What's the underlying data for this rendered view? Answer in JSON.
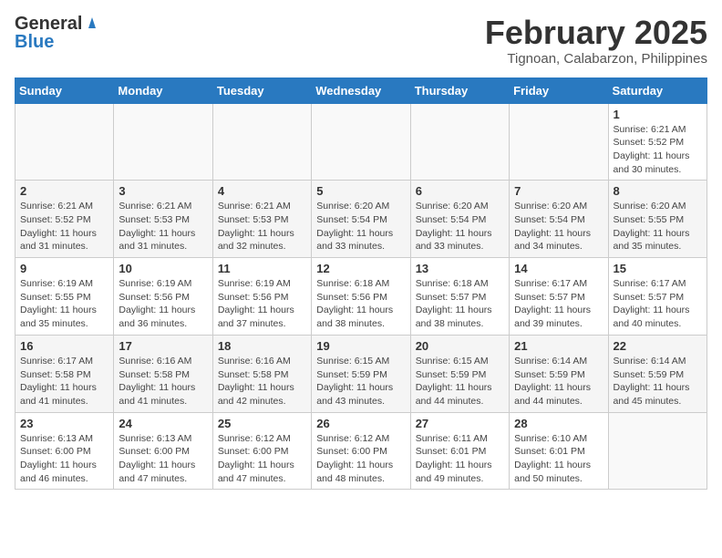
{
  "header": {
    "logo_general": "General",
    "logo_blue": "Blue",
    "main_title": "February 2025",
    "subtitle": "Tignoan, Calabarzon, Philippines"
  },
  "days_of_week": [
    "Sunday",
    "Monday",
    "Tuesday",
    "Wednesday",
    "Thursday",
    "Friday",
    "Saturday"
  ],
  "weeks": [
    [
      {
        "day": "",
        "info": ""
      },
      {
        "day": "",
        "info": ""
      },
      {
        "day": "",
        "info": ""
      },
      {
        "day": "",
        "info": ""
      },
      {
        "day": "",
        "info": ""
      },
      {
        "day": "",
        "info": ""
      },
      {
        "day": "1",
        "info": "Sunrise: 6:21 AM\nSunset: 5:52 PM\nDaylight: 11 hours and 30 minutes."
      }
    ],
    [
      {
        "day": "2",
        "info": "Sunrise: 6:21 AM\nSunset: 5:52 PM\nDaylight: 11 hours and 31 minutes."
      },
      {
        "day": "3",
        "info": "Sunrise: 6:21 AM\nSunset: 5:53 PM\nDaylight: 11 hours and 31 minutes."
      },
      {
        "day": "4",
        "info": "Sunrise: 6:21 AM\nSunset: 5:53 PM\nDaylight: 11 hours and 32 minutes."
      },
      {
        "day": "5",
        "info": "Sunrise: 6:20 AM\nSunset: 5:54 PM\nDaylight: 11 hours and 33 minutes."
      },
      {
        "day": "6",
        "info": "Sunrise: 6:20 AM\nSunset: 5:54 PM\nDaylight: 11 hours and 33 minutes."
      },
      {
        "day": "7",
        "info": "Sunrise: 6:20 AM\nSunset: 5:54 PM\nDaylight: 11 hours and 34 minutes."
      },
      {
        "day": "8",
        "info": "Sunrise: 6:20 AM\nSunset: 5:55 PM\nDaylight: 11 hours and 35 minutes."
      }
    ],
    [
      {
        "day": "9",
        "info": "Sunrise: 6:19 AM\nSunset: 5:55 PM\nDaylight: 11 hours and 35 minutes."
      },
      {
        "day": "10",
        "info": "Sunrise: 6:19 AM\nSunset: 5:56 PM\nDaylight: 11 hours and 36 minutes."
      },
      {
        "day": "11",
        "info": "Sunrise: 6:19 AM\nSunset: 5:56 PM\nDaylight: 11 hours and 37 minutes."
      },
      {
        "day": "12",
        "info": "Sunrise: 6:18 AM\nSunset: 5:56 PM\nDaylight: 11 hours and 38 minutes."
      },
      {
        "day": "13",
        "info": "Sunrise: 6:18 AM\nSunset: 5:57 PM\nDaylight: 11 hours and 38 minutes."
      },
      {
        "day": "14",
        "info": "Sunrise: 6:17 AM\nSunset: 5:57 PM\nDaylight: 11 hours and 39 minutes."
      },
      {
        "day": "15",
        "info": "Sunrise: 6:17 AM\nSunset: 5:57 PM\nDaylight: 11 hours and 40 minutes."
      }
    ],
    [
      {
        "day": "16",
        "info": "Sunrise: 6:17 AM\nSunset: 5:58 PM\nDaylight: 11 hours and 41 minutes."
      },
      {
        "day": "17",
        "info": "Sunrise: 6:16 AM\nSunset: 5:58 PM\nDaylight: 11 hours and 41 minutes."
      },
      {
        "day": "18",
        "info": "Sunrise: 6:16 AM\nSunset: 5:58 PM\nDaylight: 11 hours and 42 minutes."
      },
      {
        "day": "19",
        "info": "Sunrise: 6:15 AM\nSunset: 5:59 PM\nDaylight: 11 hours and 43 minutes."
      },
      {
        "day": "20",
        "info": "Sunrise: 6:15 AM\nSunset: 5:59 PM\nDaylight: 11 hours and 44 minutes."
      },
      {
        "day": "21",
        "info": "Sunrise: 6:14 AM\nSunset: 5:59 PM\nDaylight: 11 hours and 44 minutes."
      },
      {
        "day": "22",
        "info": "Sunrise: 6:14 AM\nSunset: 5:59 PM\nDaylight: 11 hours and 45 minutes."
      }
    ],
    [
      {
        "day": "23",
        "info": "Sunrise: 6:13 AM\nSunset: 6:00 PM\nDaylight: 11 hours and 46 minutes."
      },
      {
        "day": "24",
        "info": "Sunrise: 6:13 AM\nSunset: 6:00 PM\nDaylight: 11 hours and 47 minutes."
      },
      {
        "day": "25",
        "info": "Sunrise: 6:12 AM\nSunset: 6:00 PM\nDaylight: 11 hours and 47 minutes."
      },
      {
        "day": "26",
        "info": "Sunrise: 6:12 AM\nSunset: 6:00 PM\nDaylight: 11 hours and 48 minutes."
      },
      {
        "day": "27",
        "info": "Sunrise: 6:11 AM\nSunset: 6:01 PM\nDaylight: 11 hours and 49 minutes."
      },
      {
        "day": "28",
        "info": "Sunrise: 6:10 AM\nSunset: 6:01 PM\nDaylight: 11 hours and 50 minutes."
      },
      {
        "day": "",
        "info": ""
      }
    ]
  ]
}
